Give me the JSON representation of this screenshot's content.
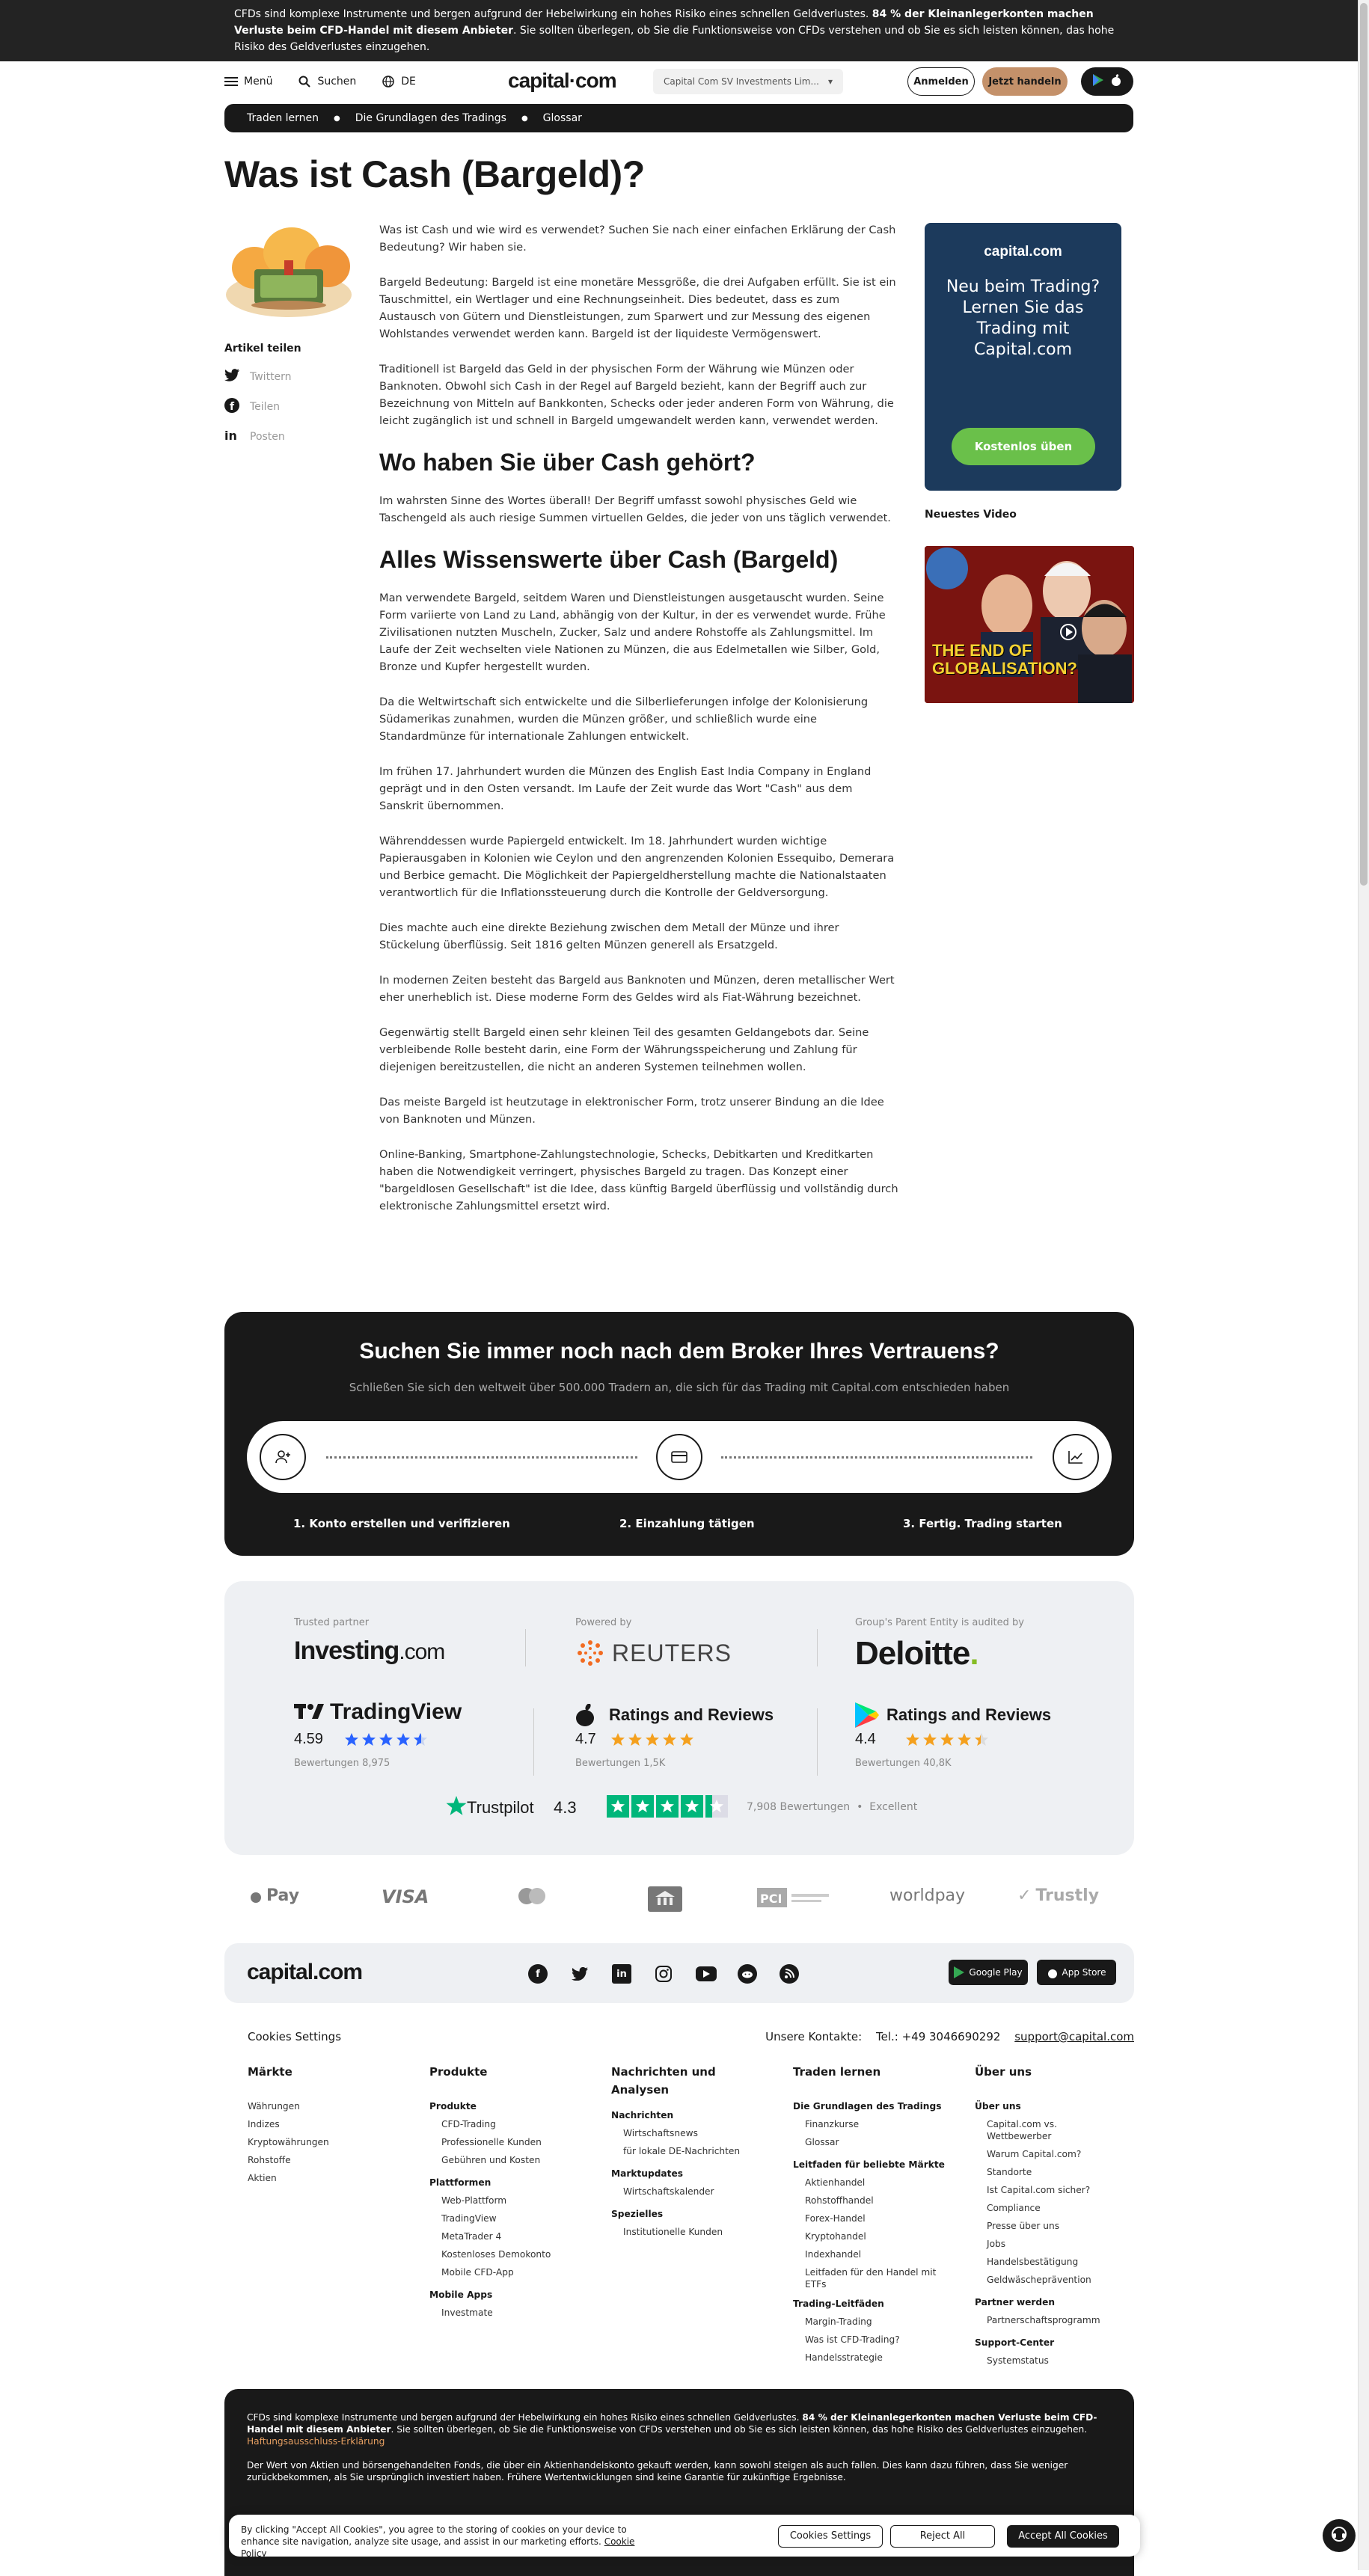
{
  "risk_banner": {
    "text1": "CFDs sind komplexe Instrumente und bergen aufgrund der Hebelwirkung ein hohes Risiko eines schnellen Geldverlustes.",
    "bold": "84 % der Kleinanlegerkonten machen Verluste beim CFD-Handel mit diesem Anbieter",
    "text2": ". Sie sollten überlegen, ob Sie die Funktionsweise von CFDs verstehen und ob Sie es sich leisten können, das hohe Risiko des Geldverlustes einzugehen."
  },
  "header": {
    "menu": "Menü",
    "search": "Suchen",
    "lang": "DE",
    "logo": "capital",
    "logo_dot": "·",
    "logo_com": "com",
    "entity": "Capital Com SV Investments Lim...",
    "signin": "Anmelden",
    "trade": "Jetzt handeln"
  },
  "breadcrumb": [
    "Traden lernen",
    "Die Grundlagen des Tradings",
    "Glossar"
  ],
  "page_title": "Was ist Cash (Bargeld)?",
  "share": {
    "heading": "Artikel teilen",
    "twitter": "Twittern",
    "facebook": "Teilen",
    "linkedin": "Posten"
  },
  "article": {
    "p1": "Was ist Cash und wie wird es verwendet? Suchen Sie nach einer einfachen Erklärung der Cash Bedeutung? Wir haben sie.",
    "p2": "Bargeld Bedeutung: Bargeld ist eine monetäre Messgröße, die drei Aufgaben erfüllt. Sie ist ein Tauschmittel, ein Wertlager und eine Rechnungseinheit. Dies bedeutet, dass es zum Austausch von Gütern und Dienstleistungen, zum Sparwert und zur Messung des eigenen Wohlstandes verwendet werden kann. Bargeld ist der liquideste Vermögenswert.",
    "p3": "Traditionell ist Bargeld das Geld in der physischen Form der Währung wie Münzen oder Banknoten. Obwohl sich Cash in der Regel auf Bargeld bezieht, kann der Begriff auch zur Bezeichnung von Mitteln auf Bankkonten, Schecks oder jeder anderen Form von Währung, die leicht zugänglich ist und schnell in Bargeld umgewandelt werden kann, verwendet werden.",
    "h2a": "Wo haben Sie über Cash gehört?",
    "p4": "Im wahrsten Sinne des Wortes überall! Der Begriff umfasst sowohl physisches Geld wie Taschengeld als auch riesige Summen virtuellen Geldes, die jeder von uns täglich verwendet.",
    "h2b": "Alles Wissenswerte über Cash (Bargeld)",
    "p5": "Man verwendete Bargeld, seitdem Waren und Dienstleistungen ausgetauscht wurden. Seine Form variierte von Land zu Land, abhängig von der Kultur, in der es verwendet wurde. Frühe Zivilisationen nutzten Muscheln, Zucker, Salz und andere Rohstoffe als Zahlungsmittel. Im Laufe der Zeit wechselten viele Nationen zu Münzen, die aus Edelmetallen wie Silber, Gold, Bronze und Kupfer hergestellt wurden.",
    "p6": "Da die Weltwirtschaft sich entwickelte und die Silberlieferungen infolge der Kolonisierung Südamerikas zunahmen, wurden die Münzen größer, und schließlich wurde eine Standardmünze für internationale Zahlungen entwickelt.",
    "p7": "Im frühen 17. Jahrhundert wurden die Münzen des English East India Company in England geprägt und in den Osten versandt. Im Laufe der Zeit wurde das Wort \"Cash\" aus dem Sanskrit übernommen.",
    "p8": "Währenddessen wurde Papiergeld entwickelt. Im 18. Jahrhundert wurden wichtige Papierausgaben in Kolonien wie Ceylon und den angrenzenden Kolonien Essequibo, Demerara und Berbice gemacht. Die Möglichkeit der Papiergeldherstellung machte die Nationalstaaten verantwortlich für die Inflationssteuerung durch die Kontrolle der Geldversorgung.",
    "p9": "Dies machte auch eine direkte Beziehung zwischen dem Metall der Münze und ihrer Stückelung überflüssig. Seit 1816 gelten Münzen generell als Ersatzgeld.",
    "p10": "In modernen Zeiten besteht das Bargeld aus Banknoten und Münzen, deren metallischer Wert eher unerheblich ist. Diese moderne Form des Geldes wird als Fiat-Währung bezeichnet.",
    "p11": "Gegenwärtig stellt Bargeld einen sehr kleinen Teil des gesamten Geldangebots dar. Seine verbleibende Rolle besteht darin, eine Form der Währungsspeicherung und Zahlung für diejenigen bereitzustellen, die nicht an anderen Systemen teilnehmen wollen.",
    "p12": "Das meiste Bargeld ist heutzutage in elektronischer Form, trotz unserer Bindung an die Idee von Banknoten und Münzen.",
    "p13": "Online-Banking, Smartphone-Zahlungstechnologie, Schecks, Debitkarten und Kreditkarten haben die Notwendigkeit verringert, physisches Bargeld zu tragen. Das Konzept einer \"bargeldlosen Gesellschaft\" ist die Idee, dass künftig Bargeld überflüssig und vollständig durch elektronische Zahlungsmittel ersetzt wird."
  },
  "promo": {
    "logo": "capital.com",
    "text": "Neu beim Trading? Lernen Sie das Trading mit Capital.com",
    "button": "Kostenlos üben"
  },
  "video": {
    "heading": "Neuestes Video",
    "caption1": "THE END OF",
    "caption2": "GLOBALISATION?"
  },
  "cta": {
    "title": "Suchen Sie immer noch nach dem Broker Ihres Vertrauens?",
    "subtitle": "Schließen Sie sich den weltweit über 500.000 Tradern an, die sich für das Trading mit Capital.com entschieden haben",
    "step1": "1. Konto erstellen und verifizieren",
    "step2": "2. Einzahlung tätigen",
    "step3": "3. Fertig. Trading starten"
  },
  "trust": {
    "investing_label": "Trusted partner",
    "investing": "Investing",
    "investing_com": ".com",
    "reuters_label": "Powered by",
    "reuters": "REUTERS",
    "deloitte_label": "Group's Parent Entity is audited by",
    "deloitte": "Deloitte",
    "tv_name": "TradingView",
    "tv_rating": "4.59",
    "tv_reviews": "Bewertungen 8,975",
    "apple_name": "Ratings and Reviews",
    "apple_rating": "4.7",
    "apple_reviews": "Bewertungen 1,5K",
    "gp_name": "Ratings and Reviews",
    "gp_rating": "4.4",
    "gp_reviews": "Bewertungen 40,8K",
    "tp_name": "Trustpilot",
    "tp_rating": "4.3",
    "tp_reviews": "7,908 Bewertungen",
    "tp_excellent": "Excellent"
  },
  "payments": [
    "Pay",
    "VISA",
    "worldpay",
    "Trustly"
  ],
  "footer": {
    "logo": "capital.com",
    "cookies": "Cookies Settings",
    "contacts_label": "Unsere Kontakte:",
    "phone": "Tel.: +49 3046690292",
    "email": "support@capital.com",
    "googleplay": "Google Play",
    "appstore": "App Store",
    "col1": {
      "title": "Märkte",
      "items": [
        "Währungen",
        "Indizes",
        "Kryptowährungen",
        "Rohstoffe",
        "Aktien"
      ]
    },
    "col2": {
      "title": "Produkte",
      "s1": "Produkte",
      "s1items": [
        "CFD-Trading",
        "Professionelle Kunden",
        "Gebühren und Kosten"
      ],
      "s2": "Plattformen",
      "s2items": [
        "Web-Plattform",
        "TradingView",
        "MetaTrader 4",
        "Kostenloses Demokonto",
        "Mobile CFD-App"
      ],
      "s3": "Mobile Apps",
      "s3items": [
        "Investmate"
      ]
    },
    "col3": {
      "title": "Nachrichten und Analysen",
      "s1": "Nachrichten",
      "s1items": [
        "Wirtschaftsnews",
        "für lokale DE-Nachrichten"
      ],
      "s2": "Marktupdates",
      "s2items": [
        "Wirtschaftskalender"
      ],
      "s3": "Spezielles",
      "s3items": [
        "Institutionelle Kunden"
      ]
    },
    "col4": {
      "title": "Traden lernen",
      "s1": "Die Grundlagen des Tradings",
      "s1items": [
        "Finanzkurse",
        "Glossar"
      ],
      "s2": "Leitfaden für beliebte Märkte",
      "s2items": [
        "Aktienhandel",
        "Rohstoffhandel",
        "Forex-Handel",
        "Kryptohandel",
        "Indexhandel",
        "Leitfaden für den Handel mit ETFs"
      ],
      "s3": "Trading-Leitfäden",
      "s3items": [
        "Margin-Trading",
        "Was ist CFD-Trading?",
        "Handelsstrategie"
      ]
    },
    "col5": {
      "title": "Über uns",
      "s1": "Über uns",
      "s1items": [
        "Capital.com vs. Wettbewerber",
        "Warum Capital.com?",
        "Standorte",
        "Ist Capital.com sicher?",
        "Compliance",
        "Presse über uns",
        "Jobs",
        "Handelsbestätigung",
        "Geldwäscheprävention"
      ],
      "s2": "Partner werden",
      "s2items": [
        "Partnerschaftsprogramm"
      ],
      "s3": "Support-Center",
      "s3items": [
        "Systemstatus"
      ]
    }
  },
  "disclaimer": {
    "d1a": "CFDs sind komplexe Instrumente und bergen aufgrund der Hebelwirkung ein hohes Risiko eines schnellen Geldverlustes.",
    "d1b": "84 % der Kleinanlegerkonten machen Verluste beim CFD-Handel mit diesem Anbieter",
    "d1c": ". Sie sollten überlegen, ob Sie die Funktionsweise von CFDs verstehen und ob Sie es sich leisten können, das hohe Risiko des Geldverlustes einzugehen.",
    "d1link": "Haftungsausschluss-Erklärung",
    "d2": "Der Wert von Aktien und börsengehandelten Fonds, die über ein Aktienhandelskonto gekauft werden, kann sowohl steigen als auch fallen. Dies kann dazu führen, dass Sie weniger zurückbekommen, als Sie ursprünglich investiert haben. Frühere Wertentwicklungen sind keine Garantie für zukünftige Ergebnisse."
  },
  "cookie": {
    "text": "By clicking \"Accept All Cookies\", you agree to the storing of cookies on your device to enhance site navigation, analyze site usage, and assist in our marketing efforts.",
    "link": "Cookie Policy",
    "settings": "Cookies Settings",
    "reject": "Reject All",
    "accept": "Accept All Cookies"
  }
}
